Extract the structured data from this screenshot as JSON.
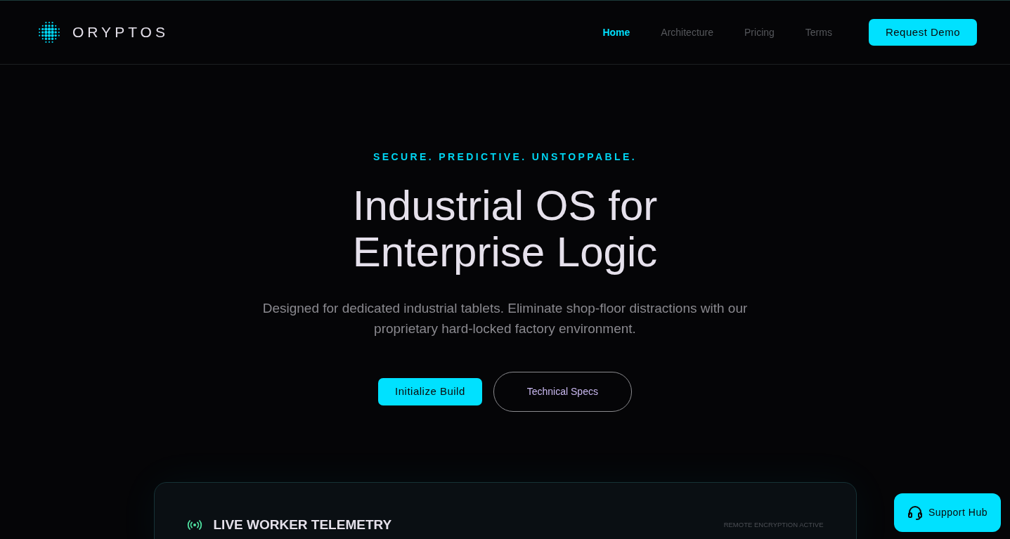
{
  "brand": {
    "name": "ORYPTOS"
  },
  "nav": [
    {
      "label": "Home",
      "selected": true
    },
    {
      "label": "Architecture",
      "selected": false
    },
    {
      "label": "Pricing",
      "selected": false
    },
    {
      "label": "Terms",
      "selected": false
    }
  ],
  "nav_button": "Request Demo",
  "hero": {
    "eyebrow": "SECURE. PREDICTIVE. UNSTOPPABLE.",
    "title_lines": [
      "Industrial OS for",
      "Enterprise Logic"
    ],
    "description": "Designed for dedicated industrial tablets. Eliminate shop-floor distractions with our proprietary hard-locked factory environment.",
    "buttons": [
      {
        "label": "Initialize Build",
        "kind": "primary"
      },
      {
        "label": "Technical Specs",
        "kind": "outline"
      }
    ]
  },
  "telemetry": {
    "title": "LIVE WORKER TELEMETRY",
    "status": "REMOTE ENCRYPTION ACTIVE"
  },
  "support_button": "Support Hub"
}
